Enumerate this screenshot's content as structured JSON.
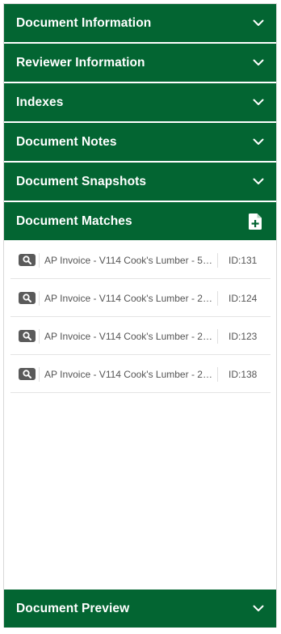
{
  "sections": {
    "document_information": "Document Information",
    "reviewer_information": "Reviewer Information",
    "indexes": "Indexes",
    "document_notes": "Document Notes",
    "document_snapshots": "Document Snapshots",
    "document_matches": "Document Matches",
    "document_preview": "Document Preview"
  },
  "matches": [
    {
      "name": "AP Invoice - V114 Cook's Lumber - 52...",
      "id": "ID:131"
    },
    {
      "name": "AP Invoice - V114 Cook's Lumber - 25...",
      "id": "ID:124"
    },
    {
      "name": "AP Invoice - V114 Cook's Lumber - 25...",
      "id": "ID:123"
    },
    {
      "name": "AP Invoice - V114 Cook's Lumber - 25...",
      "id": "ID:138"
    }
  ],
  "colors": {
    "header_bg": "#036532",
    "header_text": "#ffffff",
    "magnifier_bg": "#5a5a5a"
  },
  "icons": {
    "collapse": "chevron-down-icon",
    "add_document": "add-document-icon",
    "view_match": "magnifier-icon"
  }
}
